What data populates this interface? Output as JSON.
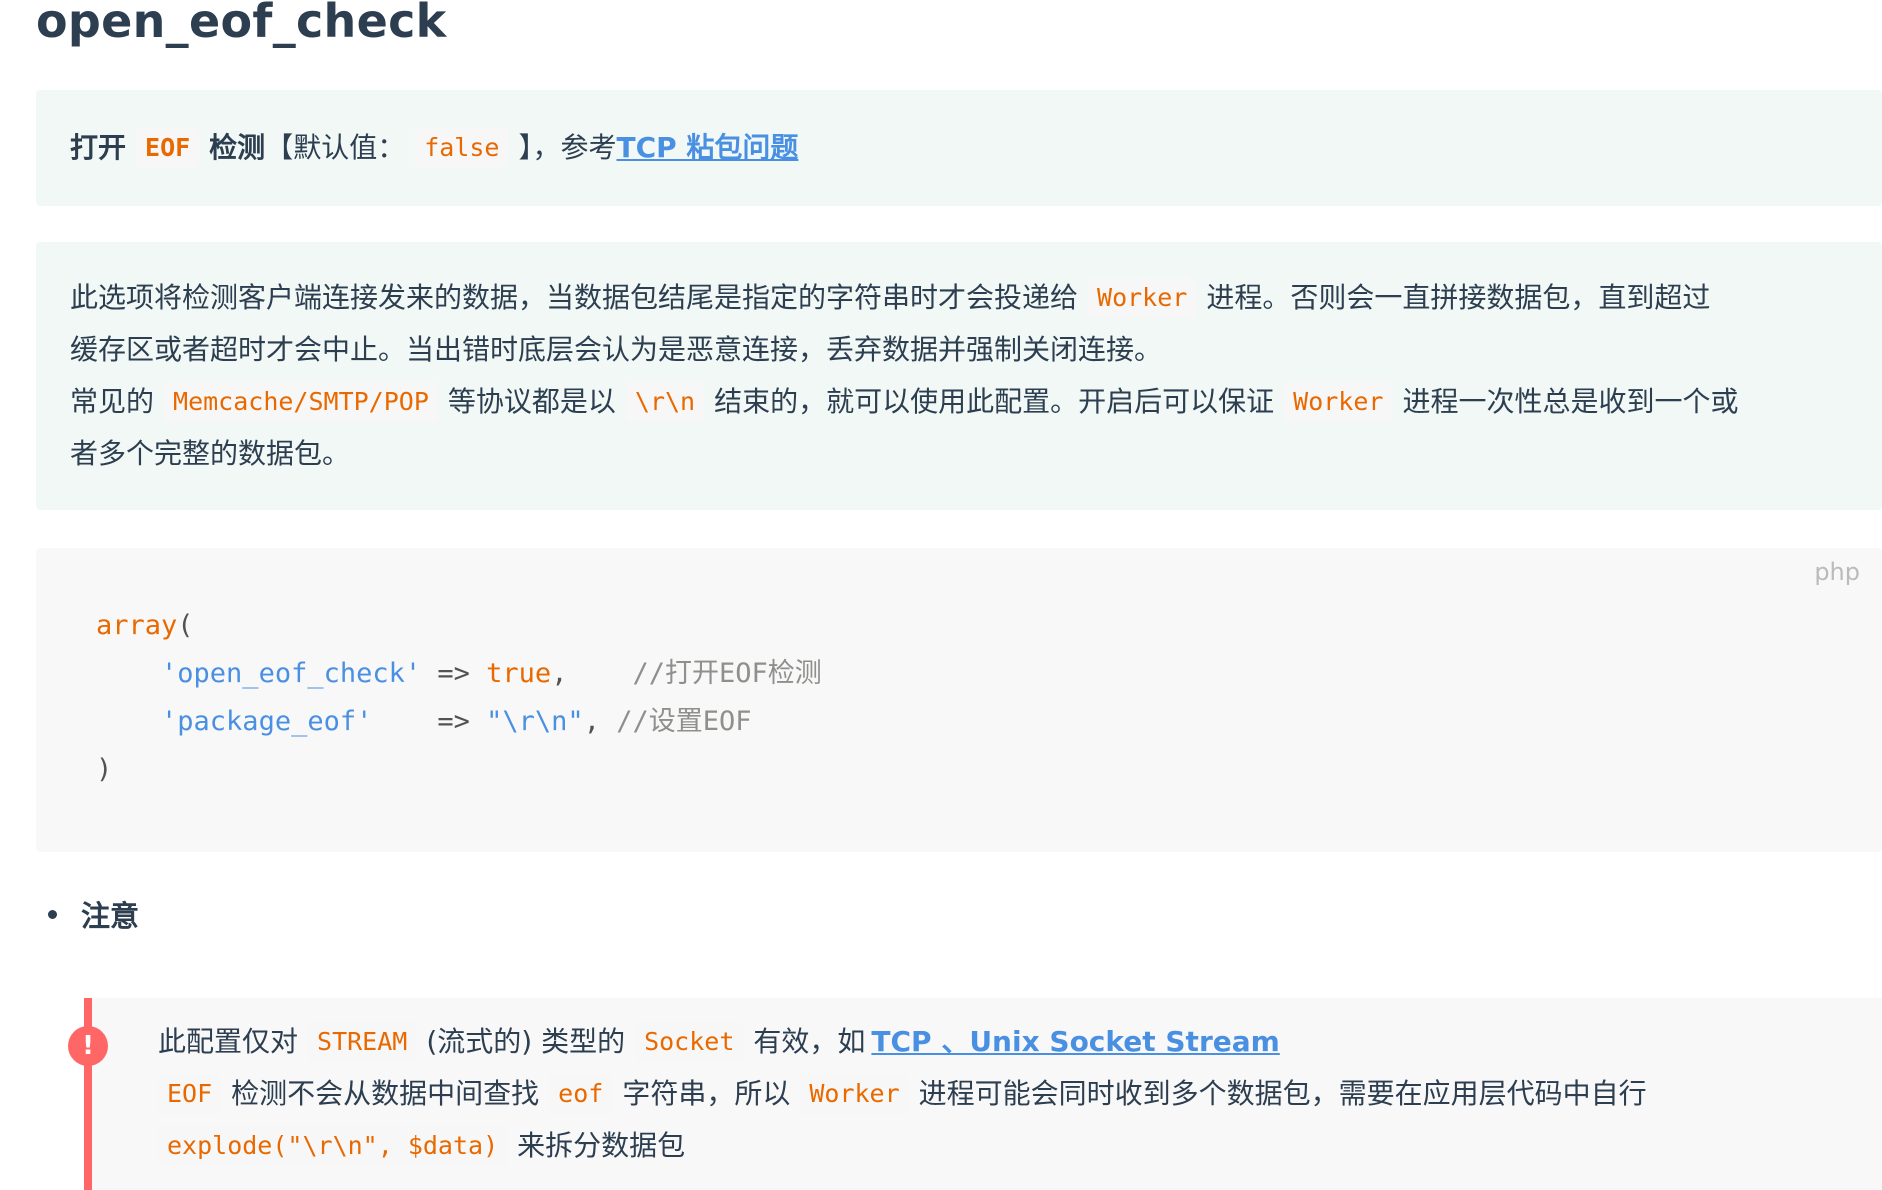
{
  "title": "open_eof_check",
  "summary": {
    "prefix": "打开",
    "code_eof": "EOF",
    "detect": "检测",
    "default_label": "【默认值：",
    "default_value": "false",
    "bracket_close": "】，参考",
    "link": "TCP 粘包问题"
  },
  "description": {
    "l1_a": "此选项将检测客户端连接发来的数据，当数据包结尾是指定的字符串时才会投递给",
    "l1_code": "Worker",
    "l1_b": "进程。否则会一直拼接数据包，直到超过",
    "l2": "缓存区或者超时才会中止。当出错时底层会认为是恶意连接，丢弃数据并强制关闭连接。",
    "l3_a": "常见的",
    "l3_code1": "Memcache/SMTP/POP",
    "l3_b": "等协议都是以",
    "l3_code2": "\\r\\n",
    "l3_c": "结束的，就可以使用此配置。开启后可以保证",
    "l3_code3": "Worker",
    "l3_d": "进程一次性总是收到一个或",
    "l4": "者多个完整的数据包。"
  },
  "code": {
    "lang": "php",
    "line1_fn": "array",
    "line1_paren": "(",
    "line2_key": "'open_eof_check'",
    "line2_arrow": " => ",
    "line2_val": "true",
    "line2_comma": ",    ",
    "line2_comment": "//打开EOF检测",
    "line3_key": "'package_eof'",
    "line3_arrow": "    => ",
    "line3_val": "\"\\r\\n\"",
    "line3_comma": ", ",
    "line3_comment": "//设置EOF",
    "line4": ")"
  },
  "notice": {
    "heading": "注意"
  },
  "warning": {
    "icon": "!",
    "w1_a": "此配置仅对",
    "w1_code1": "STREAM",
    "w1_b": "(流式的) 类型的",
    "w1_code2": "Socket",
    "w1_c": "有效，如",
    "w1_link": "TCP 、Unix Socket Stream",
    "w2_code1": "EOF",
    "w2_a": "检测不会从数据中间查找",
    "w2_code2": "eof",
    "w2_b": "字符串，所以",
    "w2_code3": "Worker",
    "w2_c": "进程可能会同时收到多个数据包，需要在应用层代码中自行",
    "w3_code": "explode(\"\\r\\n\", $data)",
    "w3_a": "来拆分数据包"
  },
  "colors": {
    "tip_bg": "#f1f8f5",
    "code_inline": "#e96900",
    "link": "#4a90e2",
    "warning": "#ff6666"
  }
}
